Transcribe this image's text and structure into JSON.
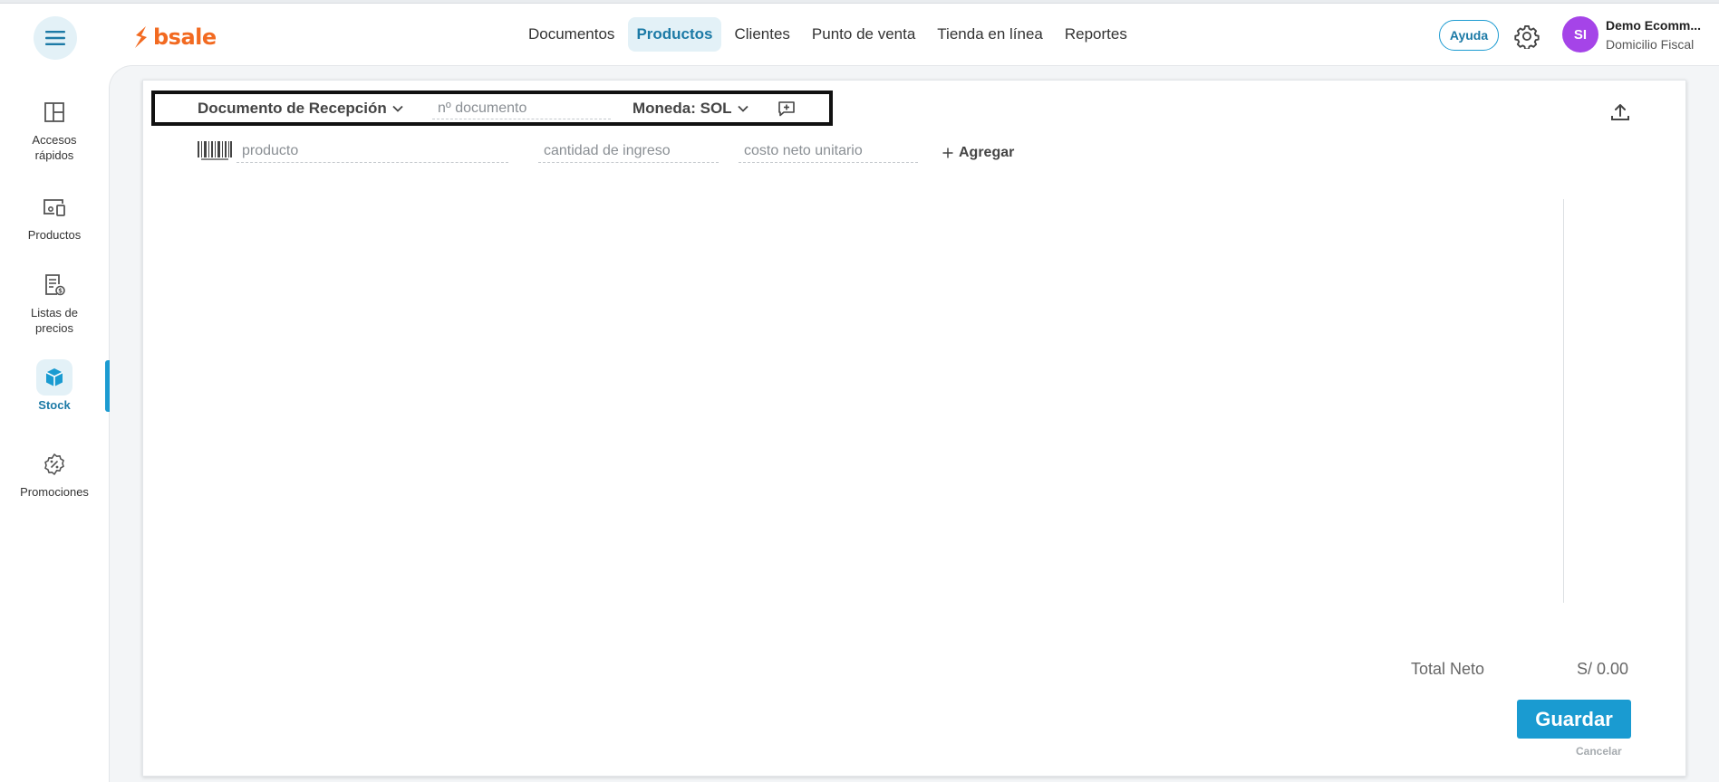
{
  "header": {
    "logo_text": "bsale",
    "nav": [
      {
        "label": "Documentos"
      },
      {
        "label": "Productos",
        "active": true
      },
      {
        "label": "Clientes"
      },
      {
        "label": "Punto de venta"
      },
      {
        "label": "Tienda en línea"
      },
      {
        "label": "Reportes"
      }
    ],
    "help_label": "Ayuda",
    "user": {
      "initials": "SI",
      "name": "Demo Ecomm...",
      "subtitle": "Domicilio Fiscal"
    }
  },
  "sidebar": {
    "items": [
      {
        "label_line1": "Accesos",
        "label_line2": "rápidos",
        "icon": "layout-icon"
      },
      {
        "label_line1": "Productos",
        "label_line2": "",
        "icon": "devices-icon"
      },
      {
        "label_line1": "Listas de",
        "label_line2": "precios",
        "icon": "price-list-icon"
      },
      {
        "label_line1": "Stock",
        "label_line2": "",
        "icon": "box-icon",
        "active": true
      },
      {
        "label_line1": "Promociones",
        "label_line2": "",
        "icon": "discount-badge-icon"
      }
    ]
  },
  "form": {
    "document_type": "Documento de Recepción",
    "document_number_placeholder": "nº documento",
    "currency": "Moneda: SOL",
    "product_placeholder": "producto",
    "quantity_placeholder": "cantidad de ingreso",
    "unit_cost_placeholder": "costo neto unitario",
    "add_label": "Agregar"
  },
  "totals": {
    "label": "Total Neto",
    "value": "S/ 0.00"
  },
  "actions": {
    "save_label": "Guardar",
    "cancel_label": "Cancelar"
  },
  "colors": {
    "brand_orange": "#f26a21",
    "accent_blue": "#1a9bd1",
    "avatar_purple": "#a544e8"
  }
}
